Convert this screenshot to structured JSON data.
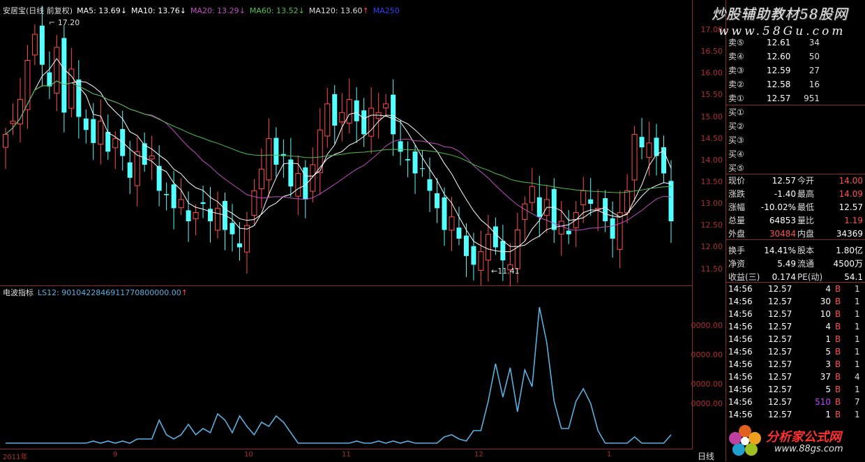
{
  "main_legend": {
    "stock_label": "安居宝(日线 前复权)",
    "ma5": "MA5: 13.69",
    "ma10": "MA10: 13.76",
    "ma20": "MA20: 13.29",
    "ma60": "MA60: 13.52",
    "ma120": "MA120: 13.60",
    "ma250": "MA250",
    "arrow_down": "↓",
    "arrow_up": "↑"
  },
  "annotations": {
    "high": "17.20",
    "low": "←11.41"
  },
  "sub_legend": {
    "name": "电波指标",
    "value": "LS12: 9010422846911770800000.00",
    "arrow": "↑"
  },
  "price_axis": [
    "17.00",
    "16.50",
    "16.00",
    "15.50",
    "15.00",
    "14.50",
    "14.00",
    "13.50",
    "13.00",
    "12.50",
    "12.00",
    "11.50"
  ],
  "sub_axis": [
    "0000.00",
    "0000.00",
    "0000.00",
    "0000.00"
  ],
  "x_axis": [
    "2011年",
    "9",
    "10",
    "11",
    "12",
    "1"
  ],
  "period_label": "日线",
  "colors": {
    "up": "#ff4d4d",
    "down": "#54ffff",
    "ma5": "#ffffff",
    "ma10": "#ffffff",
    "ma20": "#c050c0",
    "ma60": "#50c050",
    "indicator": "#5ab0e0",
    "border": "#8b2a2a"
  },
  "order_book": {
    "sell": [
      {
        "label": "卖⑤",
        "price": "12.61",
        "vol": "34"
      },
      {
        "label": "卖④",
        "price": "12.60",
        "vol": "50"
      },
      {
        "label": "卖③",
        "price": "12.59",
        "vol": "27"
      },
      {
        "label": "卖②",
        "price": "12.58",
        "vol": "16"
      },
      {
        "label": "卖①",
        "price": "12.57",
        "vol": "951"
      }
    ],
    "buy": [
      {
        "label": "买①"
      },
      {
        "label": "买②"
      },
      {
        "label": "买③"
      },
      {
        "label": "买④"
      },
      {
        "label": "买⑤"
      }
    ]
  },
  "quote": [
    {
      "l1": "现价",
      "v1": "12.57",
      "l2": "今开",
      "v2": "14.00"
    },
    {
      "l1": "涨跌",
      "v1": "-1.40",
      "l2": "最高",
      "v2": "14.09"
    },
    {
      "l1": "涨幅",
      "v1": "-10.02%",
      "l2": "最低",
      "v2": "12.57"
    },
    {
      "l1": "总量",
      "v1": "64853",
      "l2": "量比",
      "v2": "1.19"
    },
    {
      "l1": "外盘",
      "v1": "30484",
      "l2": "内盘",
      "v2": "34369"
    },
    {
      "l1": "换手",
      "v1": "14.41%",
      "l2": "股本",
      "v2": "1.80亿"
    },
    {
      "l1": "净资",
      "v1": "5.49",
      "l2": "流通",
      "v2": "4500万"
    },
    {
      "l1": "收益(三)",
      "v1": "0.174",
      "l2": "PE(动)",
      "v2": "54.1"
    }
  ],
  "ticks": [
    {
      "time": "14:56",
      "price": "12.57",
      "vol": "4",
      "side": "B",
      "n": "1"
    },
    {
      "time": "14:56",
      "price": "12.57",
      "vol": "30",
      "side": "B",
      "n": "1"
    },
    {
      "time": "14:56",
      "price": "12.57",
      "vol": "10",
      "side": "B",
      "n": "1"
    },
    {
      "time": "14:56",
      "price": "12.57",
      "vol": "4",
      "side": "B",
      "n": "1"
    },
    {
      "time": "14:56",
      "price": "12.57",
      "vol": "1",
      "side": "B",
      "n": "1"
    },
    {
      "time": "14:56",
      "price": "12.57",
      "vol": "5",
      "side": "B",
      "n": "1"
    },
    {
      "time": "14:56",
      "price": "12.57",
      "vol": "3",
      "side": "B",
      "n": "1"
    },
    {
      "time": "14:56",
      "price": "12.57",
      "vol": "37",
      "side": "B",
      "n": "4"
    },
    {
      "time": "14:56",
      "price": "12.57",
      "vol": "5",
      "side": "B",
      "n": "1"
    },
    {
      "time": "14:56",
      "price": "12.57",
      "vol": "510",
      "side": "B",
      "n": "7"
    },
    {
      "time": "14:56",
      "price": "12.57",
      "vol": "1",
      "side": "B",
      "n": "1"
    }
  ],
  "brand": {
    "top_name": "炒股辅助教材58股网",
    "top_url": "www.58Gu.com",
    "bot_name": "分析家公式网",
    "bot_url": "www.88gs.com"
  },
  "chart_data": {
    "type": "candlestick",
    "price_range": [
      11.3,
      17.4
    ],
    "candles_c": [
      14.6,
      14.9,
      15.4,
      16.3,
      16.9,
      16.2,
      15.7,
      16.6,
      15.1,
      16.1,
      15.0,
      14.7,
      14.4,
      14.9,
      14.2,
      14.5,
      14.1,
      13.6,
      14.2,
      13.9,
      14.1,
      13.3,
      13.2,
      12.9,
      13.1,
      12.6,
      12.8,
      13.0,
      12.6,
      12.9,
      12.4,
      12.3,
      12.0,
      12.5,
      13.3,
      13.8,
      14.5,
      13.9,
      14.1,
      13.4,
      13.7,
      13.1,
      13.9,
      14.7,
      15.3,
      14.8,
      15.1,
      15.4,
      14.9,
      14.6,
      15.2,
      15.1,
      15.3,
      14.6,
      14.2,
      14.0,
      13.7,
      13.8,
      13.3,
      12.9,
      12.4,
      12.7,
      12.2,
      11.8,
      11.6,
      11.9,
      12.3,
      12.0,
      11.7,
      11.6,
      12.4,
      13.0,
      13.4,
      12.7,
      13.1,
      12.4,
      12.6,
      12.3,
      12.8,
      13.3,
      13.0,
      12.9,
      12.6,
      12.2,
      12.8,
      13.3,
      14.6,
      14.3,
      14.4,
      14.1,
      13.7,
      12.6
    ],
    "indicator": [
      0,
      0,
      0,
      0,
      0,
      0,
      0,
      0,
      0,
      0,
      0,
      0,
      1,
      0,
      1,
      0,
      1,
      0,
      2,
      2,
      2,
      11,
      4,
      2,
      4,
      9,
      4,
      7,
      5,
      14,
      11,
      5,
      13,
      8,
      4,
      10,
      8,
      13,
      10,
      5,
      0,
      0,
      0,
      0,
      0,
      0,
      0,
      0,
      1,
      0,
      0,
      1,
      0,
      1,
      0,
      1,
      0,
      0,
      0,
      0,
      3,
      4,
      2,
      1,
      6,
      6,
      20,
      38,
      22,
      36,
      15,
      35,
      27,
      65,
      48,
      20,
      7,
      7,
      20,
      26,
      19,
      6,
      0,
      0,
      0,
      0,
      3,
      0,
      0,
      0,
      0,
      4
    ]
  }
}
